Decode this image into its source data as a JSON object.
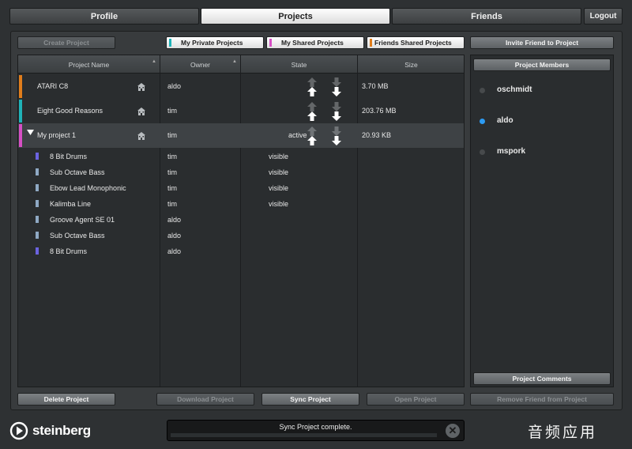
{
  "tabs": [
    {
      "label": "Profile",
      "active": false
    },
    {
      "label": "Projects",
      "active": true
    },
    {
      "label": "Friends",
      "active": false
    }
  ],
  "logout_label": "Logout",
  "toolbar": {
    "create_project": "Create Project",
    "filters": [
      {
        "label": "My Private Projects",
        "color": "#1fb3b8"
      },
      {
        "label": "My Shared Projects",
        "color": "#d64fc4"
      },
      {
        "label": "Friends Shared Projects",
        "color": "#e07d1b"
      }
    ],
    "invite_friend": "Invite Friend to Project"
  },
  "table": {
    "columns": [
      "Project Name",
      "Owner",
      "State",
      "Size"
    ],
    "projects": [
      {
        "name": "ATARI C8",
        "owner": "aldo",
        "state": "",
        "size": "3.70 MB",
        "color": "#e07d1b"
      },
      {
        "name": "Eight Good Reasons",
        "owner": "tim",
        "state": "",
        "size": "203.76 MB",
        "color": "#1fb3b8"
      },
      {
        "name": "My project 1",
        "owner": "tim",
        "state": "active",
        "size": "20.93 KB",
        "color": "#d64fc4"
      }
    ],
    "tracks": [
      {
        "name": "8 Bit Drums",
        "owner": "tim",
        "state": "visible",
        "color": "#6b63e0"
      },
      {
        "name": "Sub Octave Bass",
        "owner": "tim",
        "state": "visible",
        "color": "#8fa9c4"
      },
      {
        "name": "Ebow Lead Monophonic",
        "owner": "tim",
        "state": "visible",
        "color": "#8fa9c4"
      },
      {
        "name": "Kalimba Line",
        "owner": "tim",
        "state": "visible",
        "color": "#8fa9c4"
      },
      {
        "name": "Groove Agent SE 01",
        "owner": "aldo",
        "state": "",
        "color": "#8fa9c4"
      },
      {
        "name": "Sub Octave Bass",
        "owner": "aldo",
        "state": "",
        "color": "#8fa9c4"
      },
      {
        "name": "8 Bit Drums",
        "owner": "aldo",
        "state": "",
        "color": "#6b63e0"
      }
    ]
  },
  "side": {
    "members_title": "Project Members",
    "members": [
      {
        "name": "oschmidt",
        "online": false
      },
      {
        "name": "aldo",
        "online": true
      },
      {
        "name": "mspork",
        "online": false
      }
    ],
    "comments_label": "Project Comments"
  },
  "bottom": {
    "delete": "Delete Project",
    "download": "Download Project",
    "sync": "Sync Project",
    "open": "Open Project",
    "remove_friend": "Remove Friend from Project"
  },
  "status": {
    "message": "Sync Project complete."
  },
  "brand": "steinberg",
  "watermark": "音频应用"
}
